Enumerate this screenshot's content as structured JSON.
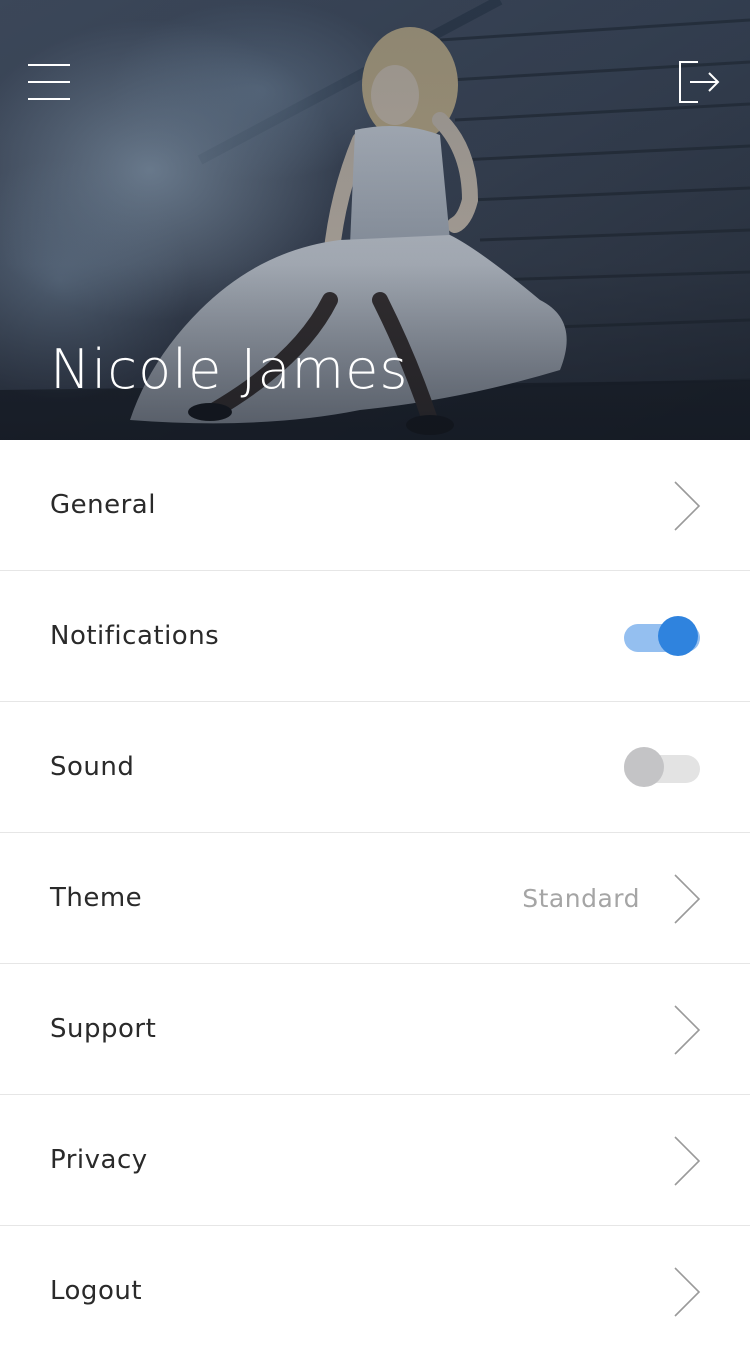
{
  "header": {
    "profile_name": "Nicole James",
    "menu_icon": "hamburger-menu-icon",
    "exit_icon": "exit-icon"
  },
  "settings": {
    "general": {
      "label": "General",
      "icon": "chevron-right-icon"
    },
    "notifications": {
      "label": "Notifications",
      "enabled": true
    },
    "sound": {
      "label": "Sound",
      "enabled": false
    },
    "theme": {
      "label": "Theme",
      "value": "Standard",
      "icon": "chevron-right-icon"
    },
    "support": {
      "label": "Support",
      "icon": "chevron-right-icon"
    },
    "privacy": {
      "label": "Privacy",
      "icon": "chevron-right-icon"
    },
    "logout": {
      "label": "Logout",
      "icon": "chevron-right-icon"
    }
  },
  "colors": {
    "accent": "#2f83de",
    "accent_track": "#94bff0",
    "toggle_off_knob": "#c4c4c6",
    "toggle_off_track": "#e3e3e3",
    "divider": "#e6e6e6",
    "text": "#2a2a2a",
    "muted_text": "#a5a5a5"
  }
}
